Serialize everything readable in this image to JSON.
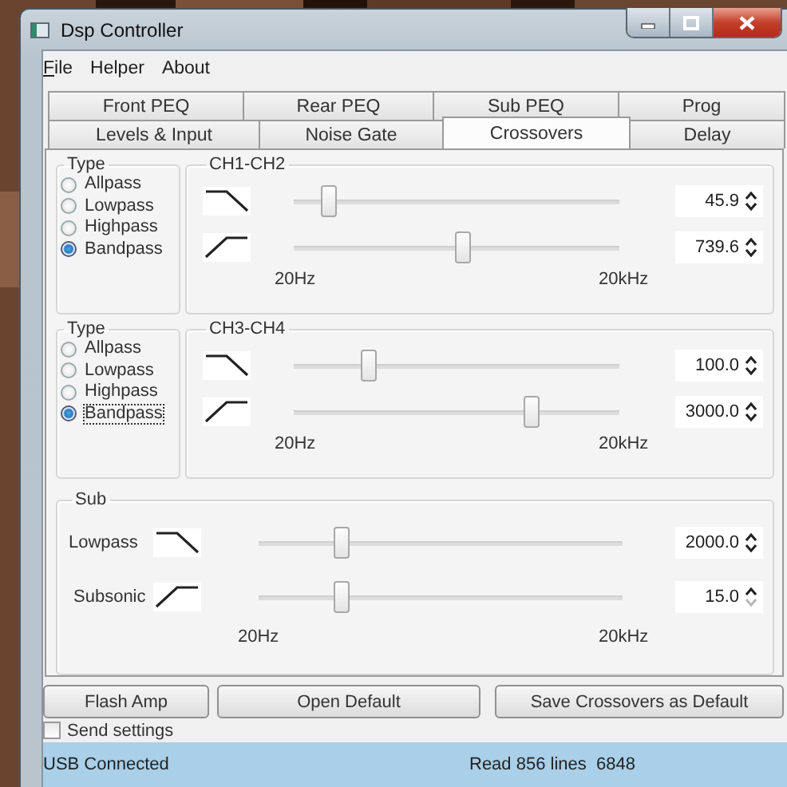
{
  "window": {
    "title": "Dsp Controller"
  },
  "menu": [
    {
      "label": "File",
      "underlined": true
    },
    {
      "label": "Helper",
      "underlined": false
    },
    {
      "label": "About",
      "underlined": false
    }
  ],
  "tab_rows": [
    [
      {
        "label": "Front PEQ",
        "selected": false
      },
      {
        "label": "Rear PEQ",
        "selected": false
      },
      {
        "label": "Sub PEQ",
        "selected": false
      },
      {
        "label": "Prog",
        "selected": false
      }
    ],
    [
      {
        "label": "Levels & Input",
        "selected": false
      },
      {
        "label": "Noise Gate",
        "selected": false
      },
      {
        "label": "Crossovers",
        "selected": true
      },
      {
        "label": "Delay",
        "selected": false
      }
    ]
  ],
  "groups": [
    {
      "type_label": "Type",
      "options": [
        {
          "label": "Allpass",
          "selected": false,
          "focused": false
        },
        {
          "label": "Lowpass",
          "selected": false,
          "focused": false
        },
        {
          "label": "Highpass",
          "selected": false,
          "focused": false
        },
        {
          "label": "Bandpass",
          "selected": true,
          "focused": false
        }
      ],
      "title": "CH1-CH2",
      "sliders": [
        {
          "kind": "lowpass",
          "level": 0.11,
          "value": "45.9",
          "down_disabled": false
        },
        {
          "kind": "highpass",
          "level": 0.52,
          "value": "739.6",
          "down_disabled": false
        }
      ],
      "scale": {
        "min": "20Hz",
        "max": "20kHz"
      }
    },
    {
      "type_label": "Type",
      "options": [
        {
          "label": "Allpass",
          "selected": false,
          "focused": false
        },
        {
          "label": "Lowpass",
          "selected": false,
          "focused": false
        },
        {
          "label": "Highpass",
          "selected": false,
          "focused": false
        },
        {
          "label": "Bandpass",
          "selected": true,
          "focused": true
        }
      ],
      "title": "CH3-CH4",
      "sliders": [
        {
          "kind": "lowpass",
          "level": 0.23,
          "value": "100.0",
          "down_disabled": false
        },
        {
          "kind": "highpass",
          "level": 0.73,
          "value": "3000.0",
          "down_disabled": false
        }
      ],
      "scale": {
        "min": "20Hz",
        "max": "20kHz"
      }
    }
  ],
  "sub": {
    "title": "Sub",
    "sliders": [
      {
        "label": "Lowpass",
        "kind": "lowpass",
        "level": 0.23,
        "value": "2000.0",
        "down_disabled": false
      },
      {
        "label": "Subsonic",
        "kind": "highpass",
        "level": 0.23,
        "value": "15.0",
        "down_disabled": true
      }
    ],
    "scale": {
      "min": "20Hz",
      "max": "20kHz"
    }
  },
  "buttons": [
    "Flash Amp",
    "Open Default",
    "Save Crossovers as Default"
  ],
  "send_settings": {
    "label": "Send settings",
    "checked": false
  },
  "status_bar": {
    "left": "USB Connected",
    "right": "Read 856 lines  6848"
  }
}
